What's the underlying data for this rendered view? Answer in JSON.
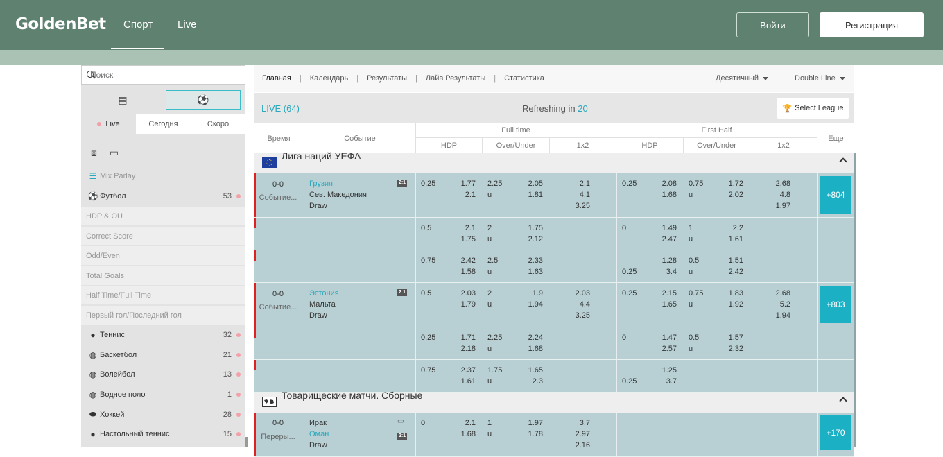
{
  "header": {
    "logo": "GoldenBet",
    "nav": [
      "Спорт",
      "Live"
    ],
    "login_label": "Войти",
    "register_label": "Регистрация"
  },
  "sidebar": {
    "search_placeholder": "Поиск",
    "time_tabs": [
      "Live",
      "Сегодня",
      "Скоро"
    ],
    "items": [
      {
        "label": "Mix Parlay",
        "count": ""
      },
      {
        "label": "Футбол",
        "count": "53"
      },
      {
        "label": "HDP & OU",
        "count": ""
      },
      {
        "label": "Correct Score",
        "count": ""
      },
      {
        "label": "Odd/Even",
        "count": ""
      },
      {
        "label": "Total Goals",
        "count": ""
      },
      {
        "label": "Half Time/Full Time",
        "count": ""
      },
      {
        "label": "Первый гол/Последний гол",
        "count": ""
      },
      {
        "label": "Теннис",
        "count": "32"
      },
      {
        "label": "Баскетбол",
        "count": "21"
      },
      {
        "label": "Волейбол",
        "count": "13"
      },
      {
        "label": "Водное поло",
        "count": "1"
      },
      {
        "label": "Хоккей",
        "count": "28"
      },
      {
        "label": "Настольный теннис",
        "count": "15"
      }
    ]
  },
  "main": {
    "breadcrumb": [
      "Главная",
      "Календарь",
      "Результаты",
      "Лайв Результаты",
      "Статистика"
    ],
    "odds_format": "Десятичный",
    "line_mode": "Double Line",
    "live_label": "LIVE (64)",
    "refresh_label": "Refreshing in",
    "refresh_seconds": "20",
    "select_league": "Select League",
    "columns": {
      "time": "Время",
      "event": "Событие",
      "full_time": "Full time",
      "first_half": "First Half",
      "more": "Еще",
      "hdp": "HDP",
      "ou": "Over/Under",
      "x12": "1x2"
    },
    "leagues": [
      {
        "name": "Лига наций УЕФА"
      },
      {
        "name": "Товарищеские матчи. Сборные"
      }
    ],
    "matches": [
      {
        "score": "0-0",
        "status": "Событие...",
        "home": "Грузия",
        "away": "Сев. Македония",
        "draw": "Draw",
        "more": "+804"
      },
      {
        "score": "0-0",
        "status": "Событие...",
        "home": "Эстония",
        "away": "Мальта",
        "draw": "Draw",
        "more": "+803"
      },
      {
        "score": "0-0",
        "status": "Переры...",
        "home": "Ирак",
        "away": "Оман",
        "draw": "Draw",
        "more": "+170"
      }
    ],
    "odds_rows": [
      {
        "ft_hdp": [
          "0.25",
          ""
        ],
        "ft_hdp_odds": [
          "1.77",
          "2.1"
        ],
        "ft_ou": [
          "2.25",
          "u"
        ],
        "ft_ou_odds": [
          "2.05",
          "1.81"
        ],
        "ft_1x2": [
          "2.1",
          "4.1",
          "3.25"
        ],
        "fh_hdp": [
          "0.25",
          ""
        ],
        "fh_hdp_odds": [
          "2.08",
          "1.68"
        ],
        "fh_ou": [
          "0.75",
          "u"
        ],
        "fh_ou_odds": [
          "1.72",
          "2.02"
        ],
        "fh_1x2": [
          "2.68",
          "4.8",
          "1.97"
        ]
      },
      {
        "ft_hdp": [
          "0.5",
          ""
        ],
        "ft_hdp_odds": [
          "2.1",
          "1.75"
        ],
        "ft_ou": [
          "2",
          "u"
        ],
        "ft_ou_odds": [
          "1.75",
          "2.12"
        ],
        "ft_1x2": [],
        "fh_hdp": [
          "0",
          ""
        ],
        "fh_hdp_odds": [
          "1.49",
          "2.47"
        ],
        "fh_ou": [
          "1",
          "u"
        ],
        "fh_ou_odds": [
          "2.2",
          "1.61"
        ],
        "fh_1x2": []
      },
      {
        "ft_hdp": [
          "0.75",
          ""
        ],
        "ft_hdp_odds": [
          "2.42",
          "1.58"
        ],
        "ft_ou": [
          "2.5",
          "u"
        ],
        "ft_ou_odds": [
          "2.33",
          "1.63"
        ],
        "ft_1x2": [],
        "fh_hdp": [
          "",
          "0.25"
        ],
        "fh_hdp_odds": [
          "1.28",
          "3.4"
        ],
        "fh_ou": [
          "0.5",
          "u"
        ],
        "fh_ou_odds": [
          "1.51",
          "2.42"
        ],
        "fh_1x2": []
      },
      {
        "ft_hdp": [
          "0.5",
          ""
        ],
        "ft_hdp_odds": [
          "2.03",
          "1.79"
        ],
        "ft_ou": [
          "2",
          "u"
        ],
        "ft_ou_odds": [
          "1.9",
          "1.94"
        ],
        "ft_1x2": [
          "2.03",
          "4.4",
          "3.25"
        ],
        "fh_hdp": [
          "0.25",
          ""
        ],
        "fh_hdp_odds": [
          "2.15",
          "1.65"
        ],
        "fh_ou": [
          "0.75",
          "u"
        ],
        "fh_ou_odds": [
          "1.83",
          "1.92"
        ],
        "fh_1x2": [
          "2.68",
          "5.2",
          "1.94"
        ]
      },
      {
        "ft_hdp": [
          "0.25",
          ""
        ],
        "ft_hdp_odds": [
          "1.71",
          "2.18"
        ],
        "ft_ou": [
          "2.25",
          "u"
        ],
        "ft_ou_odds": [
          "2.24",
          "1.68"
        ],
        "ft_1x2": [],
        "fh_hdp": [
          "0",
          ""
        ],
        "fh_hdp_odds": [
          "1.47",
          "2.57"
        ],
        "fh_ou": [
          "0.5",
          "u"
        ],
        "fh_ou_odds": [
          "1.57",
          "2.32"
        ],
        "fh_1x2": []
      },
      {
        "ft_hdp": [
          "0.75",
          ""
        ],
        "ft_hdp_odds": [
          "2.37",
          "1.61"
        ],
        "ft_ou": [
          "1.75",
          "u"
        ],
        "ft_ou_odds": [
          "1.65",
          "2.3"
        ],
        "ft_1x2": [],
        "fh_hdp": [
          "",
          "0.25"
        ],
        "fh_hdp_odds": [
          "1.25",
          "3.7"
        ],
        "fh_ou": [
          "",
          ""
        ],
        "fh_ou_odds": [
          "",
          ""
        ],
        "fh_1x2": []
      },
      {
        "ft_hdp": [
          "0",
          ""
        ],
        "ft_hdp_odds": [
          "2.1",
          "1.68"
        ],
        "ft_ou": [
          "1",
          "u"
        ],
        "ft_ou_odds": [
          "1.97",
          "1.78"
        ],
        "ft_1x2": [
          "3.7",
          "2.97",
          "2.16"
        ],
        "fh_hdp": [
          "",
          ""
        ],
        "fh_hdp_odds": [
          "",
          ""
        ],
        "fh_ou": [
          "",
          ""
        ],
        "fh_ou_odds": [
          "",
          ""
        ],
        "fh_1x2": []
      }
    ],
    "tag_21": "2:1",
    "colors": {
      "accent": "#1bb0c4",
      "header": "#5f8170",
      "row": "#b8d0d4",
      "live_mark": "#e02020"
    }
  }
}
